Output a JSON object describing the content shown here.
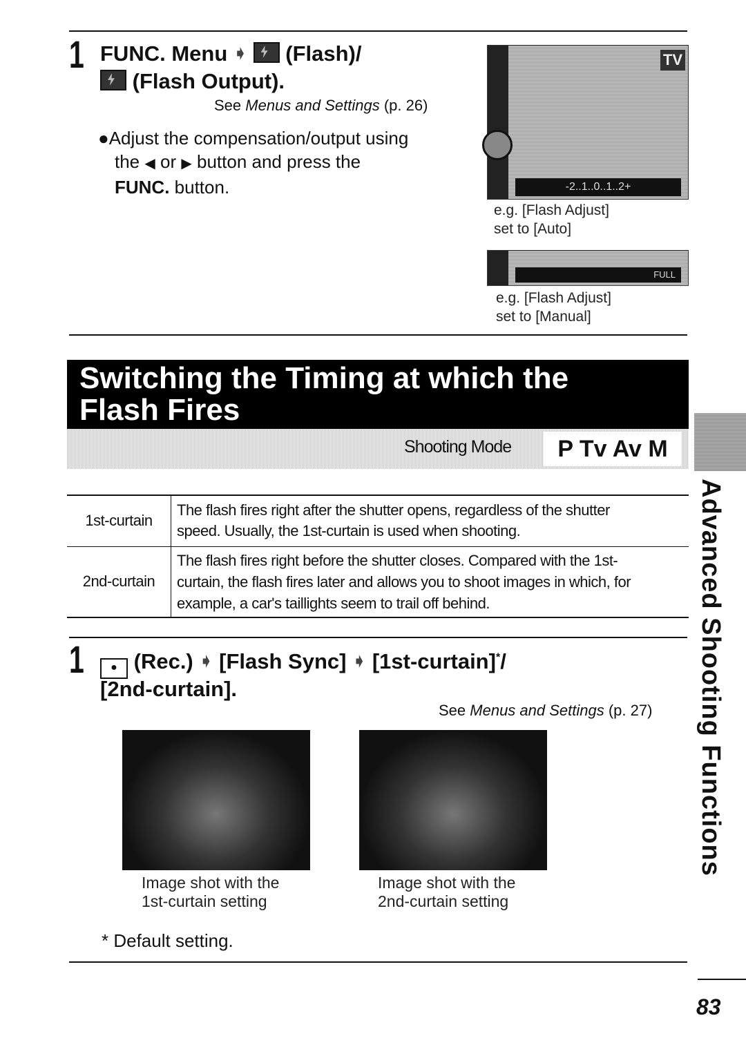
{
  "section1": {
    "step_number": "1",
    "heading_line1_a": "FUNC. Menu",
    "heading_line1_b": "(Flash)/",
    "heading_line2": "(Flash Output).",
    "see_ref_prefix": "See ",
    "see_ref_italic": "Menus and Settings",
    "see_ref_suffix": " (p. 26)",
    "bullet_line1": "Adjust the compensation/output using",
    "bullet_line2_a": "the",
    "bullet_line2_b": "or",
    "bullet_line2_c": "button and press the",
    "bullet_line3_a": "FUNC.",
    "bullet_line3_b": " button.",
    "screen1_caption_line1": "e.g. [Flash Adjust]",
    "screen1_caption_line2": "set to [Auto]",
    "screen2_caption_line1": "e.g. [Flash Adjust]",
    "screen2_caption_line2": "set to [Manual]",
    "screen1_scale": "-2..1..0..1..2+",
    "screen1_mode": "TV",
    "screen2_label": "FULL"
  },
  "banner": {
    "title_line1": "Switching the Timing at which the",
    "title_line2": "Flash Fires",
    "shooting_mode_label": "Shooting Mode",
    "modes": "P Tv Av M"
  },
  "table": {
    "rows": [
      {
        "label": "1st-curtain",
        "text": [
          "The flash fires right after the shutter opens, regardless of the shutter",
          "speed. Usually, the 1st-curtain is used when shooting."
        ]
      },
      {
        "label": "2nd-curtain",
        "text": [
          "The flash fires right before the shutter closes. Compared with the 1st-",
          "curtain, the flash fires later and allows you to shoot images in which, for",
          "example, a car's taillights seem to trail off behind."
        ]
      }
    ]
  },
  "section2": {
    "step_number": "1",
    "heading_a": "(Rec.)",
    "heading_b": "[Flash Sync]",
    "heading_c": "[1st-curtain]",
    "heading_sup": "*",
    "heading_d": "/",
    "heading_line2": "[2nd-curtain].",
    "see_ref_prefix": "See ",
    "see_ref_italic": "Menus and Settings",
    "see_ref_suffix": " (p. 27)",
    "photo1_caption_line1": "Image shot with the",
    "photo1_caption_line2": "1st-curtain setting",
    "photo2_caption_line1": "Image shot with the",
    "photo2_caption_line2": "2nd-curtain setting",
    "footnote": "* Default setting."
  },
  "side_tab": "Advanced Shooting Functions",
  "page_number": "83"
}
